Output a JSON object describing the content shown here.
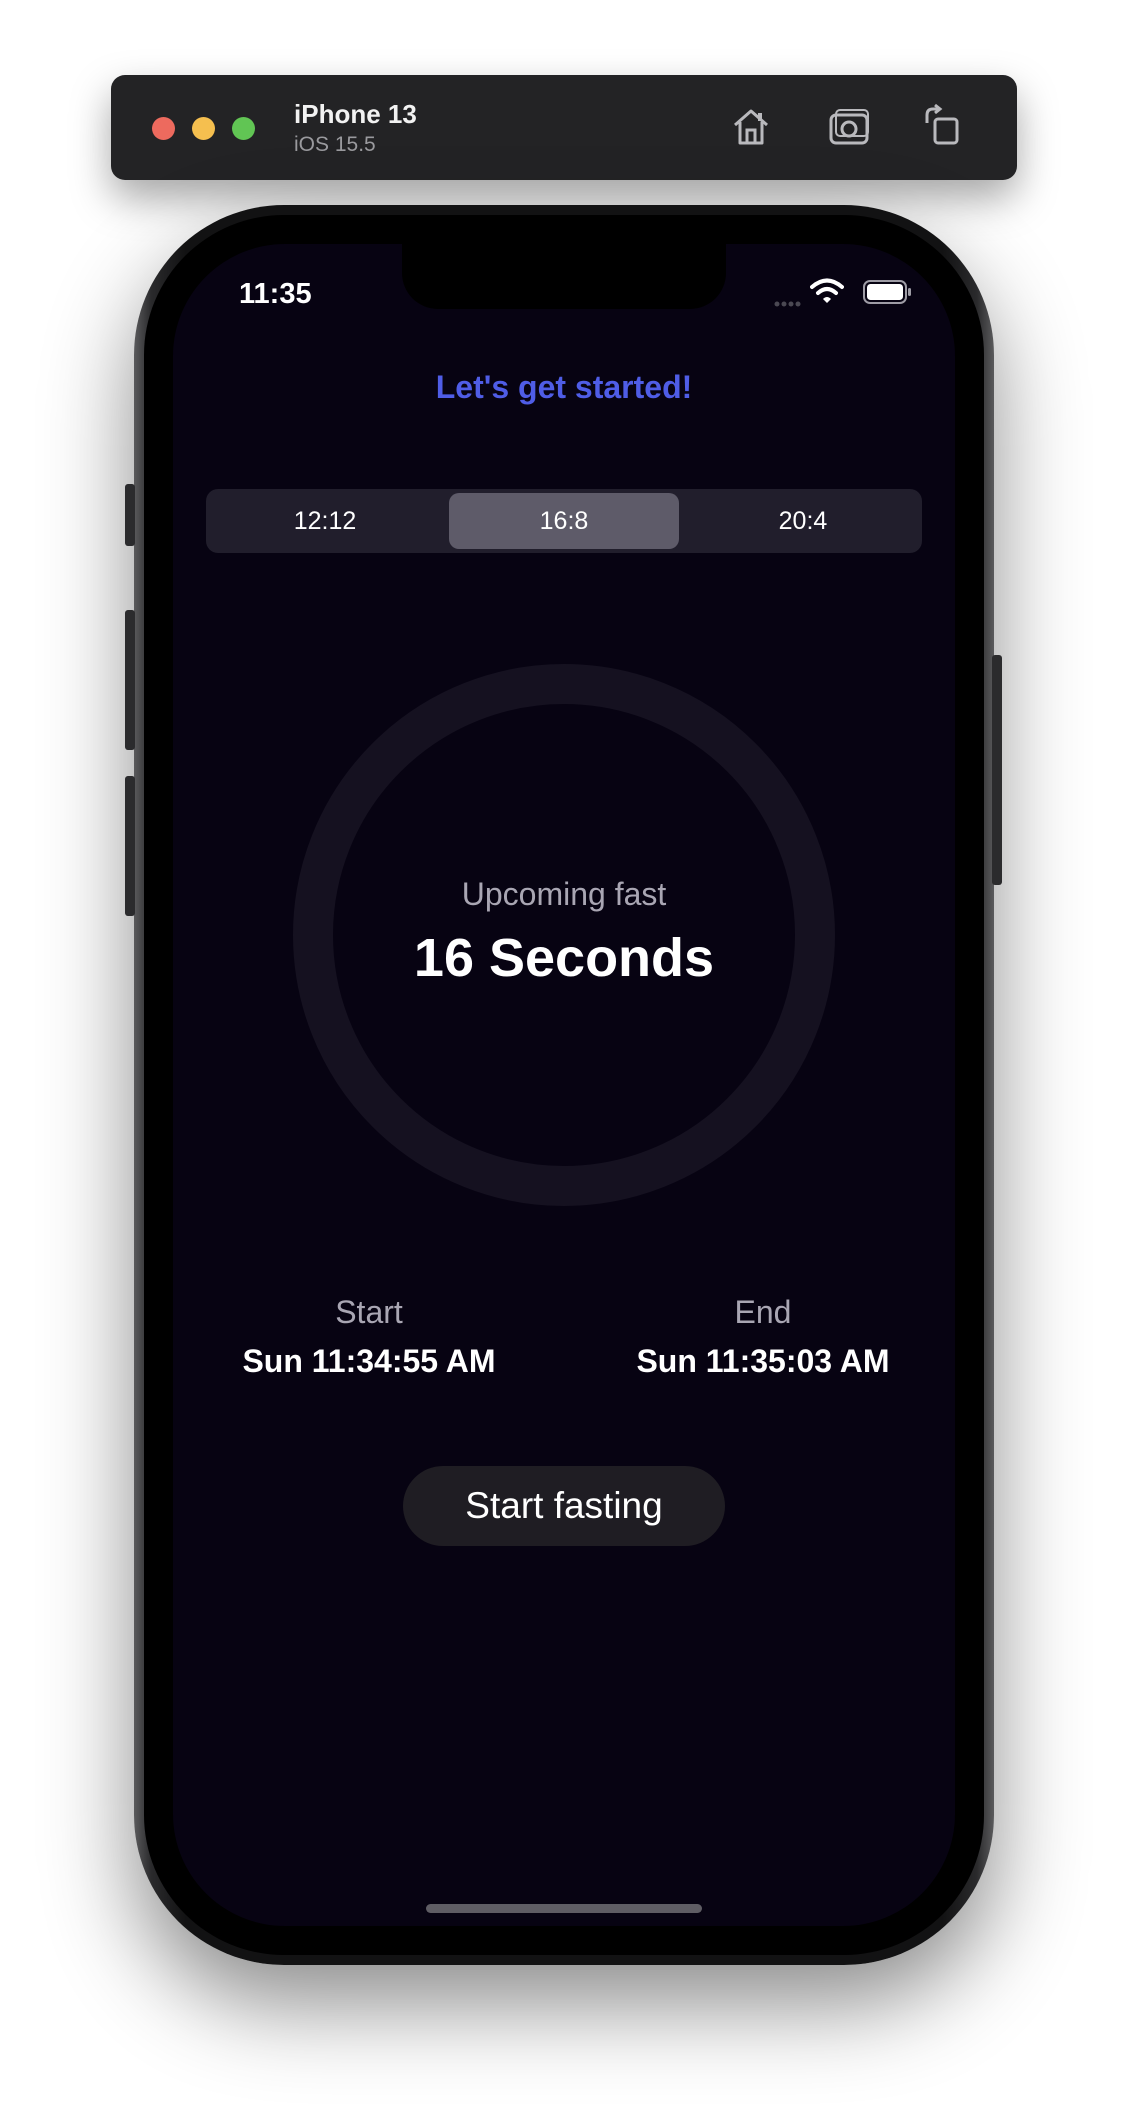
{
  "simulator": {
    "device_name": "iPhone 13",
    "os_version": "iOS 15.5",
    "icons": [
      "home-icon",
      "screenshot-icon",
      "rotate-icon"
    ]
  },
  "status_bar": {
    "time": "11:35"
  },
  "app": {
    "headline": "Let's get started!",
    "segments": [
      "12:12",
      "16:8",
      "20:4"
    ],
    "selected_segment": "16:8",
    "ring": {
      "label": "Upcoming fast",
      "value": "16 Seconds"
    },
    "start": {
      "label": "Start",
      "value": "Sun 11:34:55 AM"
    },
    "end": {
      "label": "End",
      "value": "Sun 11:35:03 AM"
    },
    "cta_label": "Start fasting"
  },
  "colors": {
    "accent": "#4f5de6",
    "background": "#070312",
    "segment_bg": "#211e2c",
    "segment_selected": "#5e5b69",
    "ring": "#151120"
  }
}
